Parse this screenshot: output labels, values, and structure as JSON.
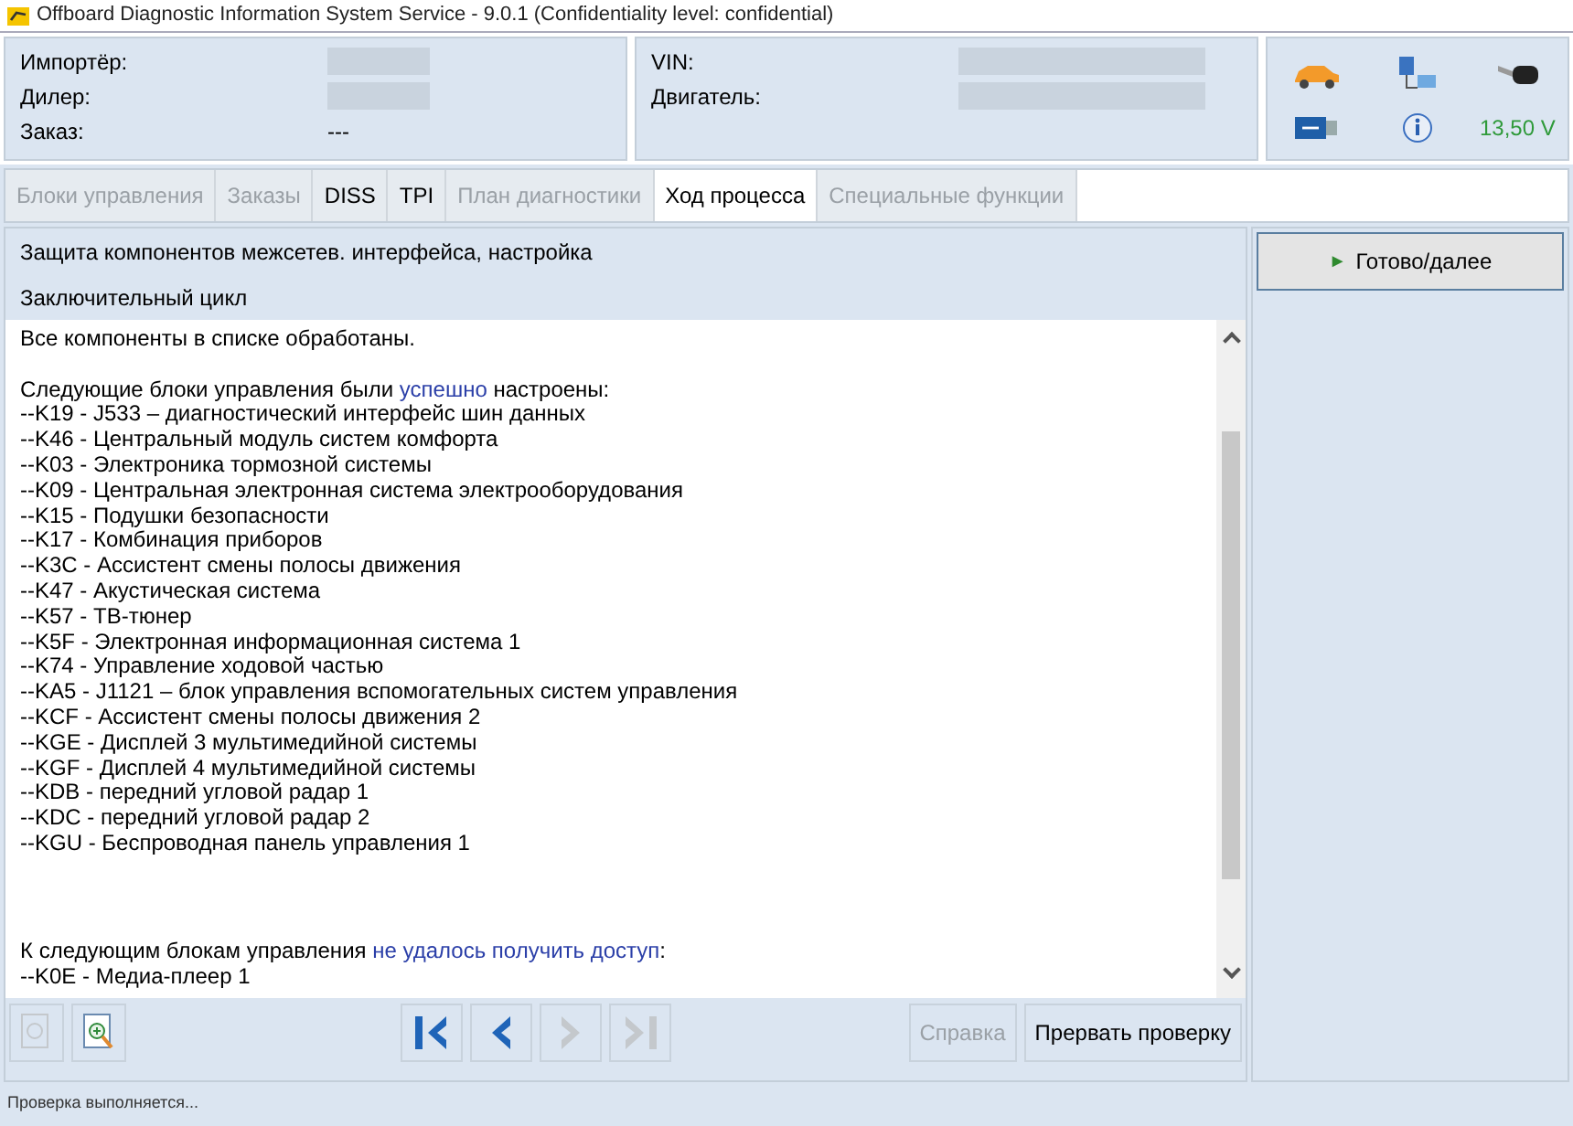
{
  "window": {
    "title": "Offboard Diagnostic Information System Service - 9.0.1 (Confidentiality level: confidential)"
  },
  "header": {
    "left": [
      {
        "label": "Импортёр:",
        "redacted": true
      },
      {
        "label": "Дилер:",
        "redacted": true
      },
      {
        "label": "Заказ:",
        "value": "---"
      }
    ],
    "right": [
      {
        "label": "VIN:",
        "redacted": true
      },
      {
        "label": "Двигатель:",
        "redacted": true
      }
    ],
    "voltage": "13,50 V"
  },
  "tabs": [
    {
      "label": "Блоки управления",
      "selected": false,
      "disabled": true
    },
    {
      "label": "Заказы",
      "selected": false,
      "disabled": true
    },
    {
      "label": "DISS",
      "selected": false,
      "disabled": false
    },
    {
      "label": "TPI",
      "selected": false,
      "disabled": false
    },
    {
      "label": "План диагностики",
      "selected": false,
      "disabled": true
    },
    {
      "label": "Ход процесса",
      "selected": true,
      "disabled": false
    },
    {
      "label": "Специальные функции",
      "selected": false,
      "disabled": true
    }
  ],
  "section_titles": [
    "Защита компонентов межсетев. интерфейса, настройка",
    "Заключительный цикл"
  ],
  "report": [
    {
      "segments": [
        {
          "text": "Все компоненты в списке обработаны.",
          "highlight": false
        }
      ]
    },
    {
      "segments": [
        {
          "text": "Следующие блоки управления были ",
          "highlight": false
        },
        {
          "text": "успешно",
          "highlight": true
        },
        {
          "text": " настроены:",
          "highlight": false
        }
      ],
      "items": [
        "--K19 - J533 – диагностический интерфейс шин данных",
        "--K46 - Центральный модуль систем комфорта",
        "--K03 - Электроника тормозной системы",
        "--K09 - Центральная электронная система электрооборудования",
        "--K15 - Подушки безопасности",
        "--K17 - Комбинация приборов",
        "--K3C - Ассистент смены полосы движения",
        "--K47 - Акустическая система",
        "--K57 - ТВ-тюнер",
        "--K5F - Электронная информационная система 1",
        "--K74 - Управление ходовой частью",
        "--KA5 - J1121 – блок управления вспомогательных систем управления",
        "--KCF - Ассистент смены полосы движения 2",
        "--KGE - Дисплей 3 мультимедийной системы",
        "--KGF - Дисплей 4 мультимедийной системы",
        "--KDB - передний угловой радар 1",
        "--KDC - передний угловой радар 2",
        "--KGU - Беспроводная панель управления 1"
      ]
    },
    {
      "segments": [
        {
          "text": "К следующим блокам управления ",
          "highlight": false
        },
        {
          "text": "не удалось получить доступ",
          "highlight": true
        },
        {
          "text": ":",
          "highlight": false
        }
      ],
      "items": [
        "--K0E - Медиа-плеер 1"
      ]
    }
  ],
  "toolbar": {
    "zoom_out_disabled": true,
    "zoom_in_disabled": false,
    "nav": [
      {
        "kind": "first",
        "disabled": false
      },
      {
        "kind": "prev",
        "disabled": false
      },
      {
        "kind": "next",
        "disabled": true
      },
      {
        "kind": "last",
        "disabled": true
      }
    ],
    "buttons": [
      {
        "label": "Справка",
        "disabled": true
      },
      {
        "label": "Прервать проверку",
        "disabled": false
      }
    ]
  },
  "next_button": {
    "symbol": "►",
    "label": "Готово/далее"
  },
  "status_bar": "Проверка выполняется..."
}
